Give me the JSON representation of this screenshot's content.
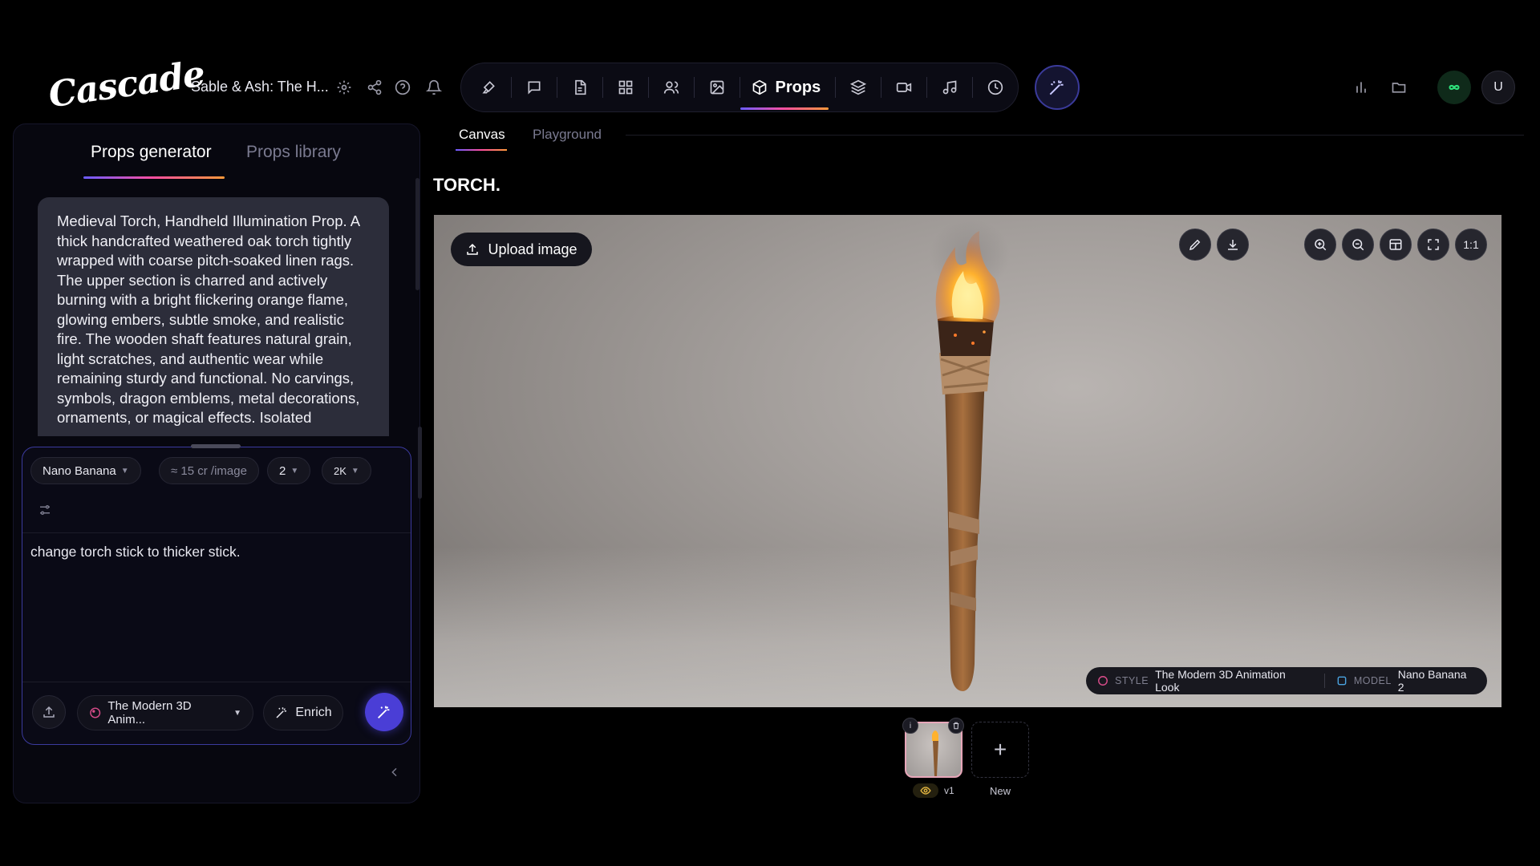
{
  "app": {
    "logo": "Cascade",
    "project_title": "Sable & Ash: The H..."
  },
  "toolbar": {
    "active_label": "Props"
  },
  "user": {
    "initial": "U"
  },
  "left_panel": {
    "tabs": {
      "generator": "Props generator",
      "library": "Props library"
    },
    "prompt_text": "Medieval Torch, Handheld Illumination Prop. A thick handcrafted weathered oak torch tightly wrapped with coarse pitch-soaked linen rags. The upper section is charred and actively burning with a bright flickering orange flame, glowing embers, subtle smoke, and realistic fire. The wooden shaft features natural grain, light scratches, and authentic wear while remaining sturdy and functional. No carvings, symbols, dragon emblems, metal decorations, ornaments, or magical effects. Isolated",
    "composer": {
      "model": "Nano Banana",
      "cost": "≈ 15 cr /image",
      "count": "2",
      "resolution": "2K",
      "input_value": "change torch stick to thicker stick.",
      "style": "The Modern 3D Anim...",
      "enrich": "Enrich"
    }
  },
  "canvas": {
    "tabs": {
      "canvas": "Canvas",
      "playground": "Playground"
    },
    "title": "TORCH.",
    "upload_label": "Upload image",
    "ratio_label": "1:1",
    "meta": {
      "style_key": "STYLE",
      "style_value": "The Modern 3D Animation Look",
      "model_key": "MODEL",
      "model_value": "Nano Banana 2"
    }
  },
  "versions": {
    "v1_label": "v1",
    "new_label": "New"
  },
  "colors": {
    "accent": "#4a3ed6",
    "gradient_start": "#6a5cff",
    "gradient_mid": "#ff4fa0",
    "gradient_end": "#ff9a3a",
    "status_green": "#2ee07a"
  }
}
